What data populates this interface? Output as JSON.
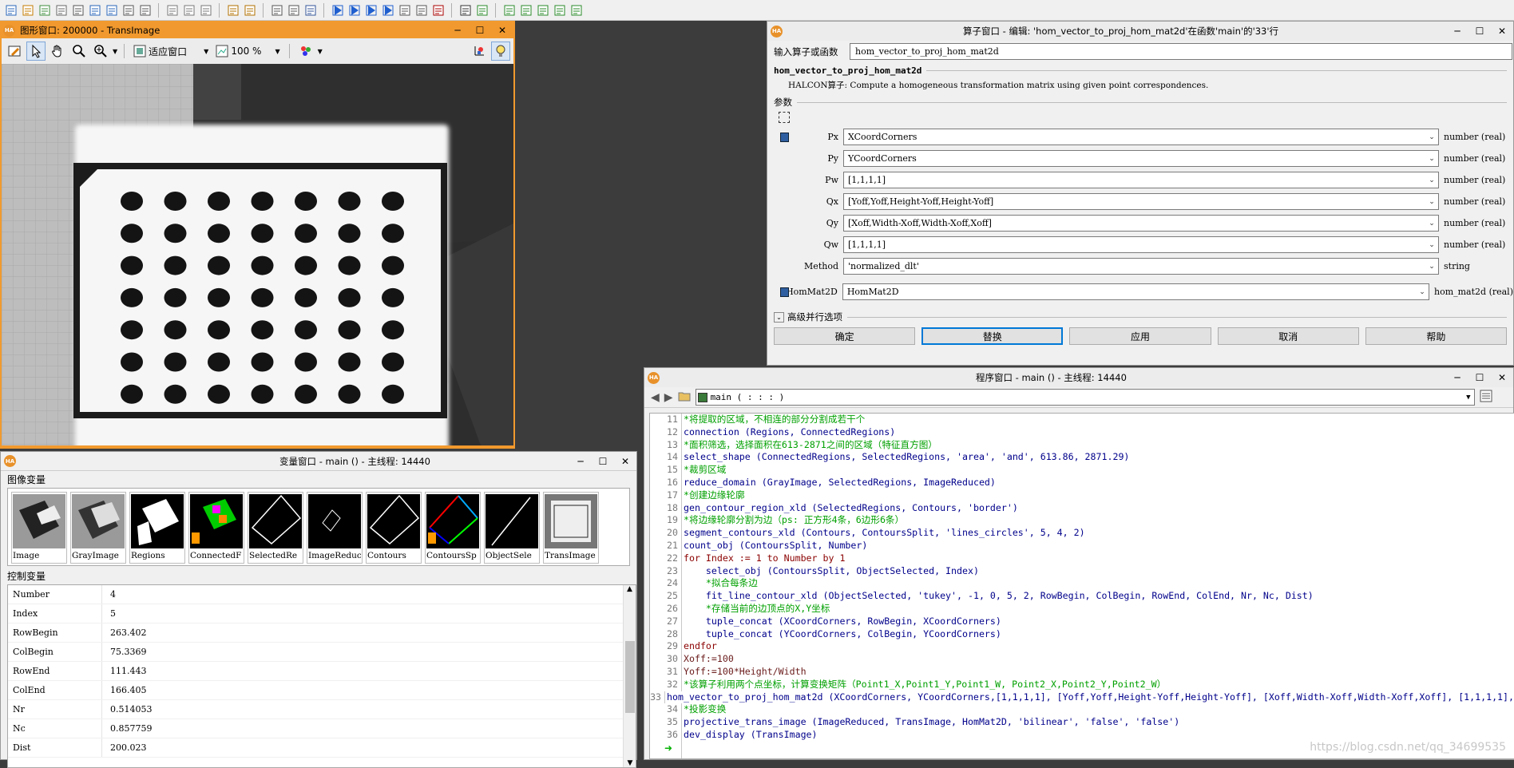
{
  "toolbar": {
    "icons": [
      "new-file-icon",
      "open-icon",
      "open-example-icon",
      "save-icon",
      "save-all-icon",
      "import-icon",
      "export-icon",
      "print-icon",
      "properties-icon",
      "cut-icon",
      "copy-icon",
      "paste-icon",
      "undo-icon",
      "redo-icon",
      "indent-icon",
      "outdent-icon",
      "find-icon",
      "run-icon",
      "step-over-icon",
      "step-into-icon",
      "step-out-icon",
      "stop-icon",
      "reset-icon",
      "breakpoint-icon",
      "profiler-icon",
      "chart-icon",
      "histogram-icon",
      "line-profile-icon",
      "feature-icon",
      "zoom-icon",
      "ocr-icon"
    ]
  },
  "graphics_window": {
    "title": "图形窗口: 200000 - TransImage",
    "fit_label": "适应窗口",
    "zoom_label": "100 %",
    "dots_rows": 7,
    "dots_cols": 7
  },
  "variable_window": {
    "title": "变量窗口 - main () - 主线程: 14440",
    "image_group": "图像变量",
    "control_group": "控制变量",
    "image_vars": [
      "Image",
      "GrayImage",
      "Regions",
      "ConnectedF",
      "SelectedRe",
      "ImageReduc",
      "Contours",
      "ContoursSp",
      "ObjectSele",
      "TransImage"
    ],
    "control_vars": [
      {
        "name": "Number",
        "value": "4"
      },
      {
        "name": "Index",
        "value": "5"
      },
      {
        "name": "RowBegin",
        "value": "263.402"
      },
      {
        "name": "ColBegin",
        "value": "75.3369"
      },
      {
        "name": "RowEnd",
        "value": "111.443"
      },
      {
        "name": "ColEnd",
        "value": "166.405"
      },
      {
        "name": "Nr",
        "value": "0.514053"
      },
      {
        "name": "Nc",
        "value": "0.857759"
      },
      {
        "name": "Dist",
        "value": "200.023"
      }
    ]
  },
  "operator_window": {
    "title": "算子窗口 - 编辑: 'hom_vector_to_proj_hom_mat2d'在函数'main'的'33'行",
    "input_label": "输入算子或函数",
    "input_value": "hom_vector_to_proj_hom_mat2d",
    "op_name": "hom_vector_to_proj_hom_mat2d",
    "description": "HALCON算子: Compute a homogeneous transformation matrix using given point correspondences.",
    "params_label": "参数",
    "params": [
      {
        "name": "Px",
        "value": "XCoordCorners",
        "type": "number (real)"
      },
      {
        "name": "Py",
        "value": "YCoordCorners",
        "type": "number (real)"
      },
      {
        "name": "Pw",
        "value": "[1,1,1,1]",
        "type": "number (real)"
      },
      {
        "name": "Qx",
        "value": "[Yoff,Yoff,Height-Yoff,Height-Yoff]",
        "type": "number (real)"
      },
      {
        "name": "Qy",
        "value": "[Xoff,Width-Xoff,Width-Xoff,Xoff]",
        "type": "number (real)"
      },
      {
        "name": "Qw",
        "value": "[1,1,1,1]",
        "type": "number (real)"
      },
      {
        "name": "Method",
        "value": "'normalized_dlt'",
        "type": "string"
      },
      {
        "name": "HomMat2D",
        "value": "HomMat2D",
        "type": "hom_mat2d (real)"
      }
    ],
    "advanced_label": "高级并行选项",
    "buttons": {
      "ok": "确定",
      "replace": "替换",
      "apply": "应用",
      "cancel": "取消",
      "help": "帮助"
    }
  },
  "program_window": {
    "title": "程序窗口 - main () - 主线程: 14440",
    "proc_label": "main ( : : : )",
    "lines": [
      {
        "n": "11",
        "t": "*将提取的区域，不相连的部分分割成若干个",
        "k": "com"
      },
      {
        "n": "12",
        "t": "connection (Regions, ConnectedRegions)",
        "k": "op"
      },
      {
        "n": "13",
        "t": "*面积筛选，选择面积在613-2871之间的区域（特征直方图）",
        "k": "com"
      },
      {
        "n": "14",
        "t": "select_shape (ConnectedRegions, SelectedRegions, 'area', 'and', 613.86, 2871.29)",
        "k": "op"
      },
      {
        "n": "15",
        "t": "*裁剪区域",
        "k": "com"
      },
      {
        "n": "16",
        "t": "reduce_domain (GrayImage, SelectedRegions, ImageReduced)",
        "k": "op"
      },
      {
        "n": "17",
        "t": "*创建边缘轮廓",
        "k": "com"
      },
      {
        "n": "18",
        "t": "gen_contour_region_xld (SelectedRegions, Contours, 'border')",
        "k": "op"
      },
      {
        "n": "19",
        "t": "*将边缘轮廓分割为边（ps: 正方形4条，6边形6条）",
        "k": "com"
      },
      {
        "n": "20",
        "t": "segment_contours_xld (Contours, ContoursSplit, 'lines_circles', 5, 4, 2)",
        "k": "op"
      },
      {
        "n": "21",
        "t": "count_obj (ContoursSplit, Number)",
        "k": "op"
      },
      {
        "n": "22",
        "t": "for Index := 1 to Number by 1",
        "k": "ctl"
      },
      {
        "n": "23",
        "t": "    select_obj (ContoursSplit, ObjectSelected, Index)",
        "k": "op"
      },
      {
        "n": "24",
        "t": "    *拟合每条边",
        "k": "com"
      },
      {
        "n": "25",
        "t": "    fit_line_contour_xld (ObjectSelected, 'tukey', -1, 0, 5, 2, RowBegin, ColBegin, RowEnd, ColEnd, Nr, Nc, Dist)",
        "k": "op"
      },
      {
        "n": "26",
        "t": "    *存储当前的边顶点的X,Y坐标",
        "k": "com"
      },
      {
        "n": "27",
        "t": "    tuple_concat (XCoordCorners, RowBegin, XCoordCorners)",
        "k": "op"
      },
      {
        "n": "28",
        "t": "    tuple_concat (YCoordCorners, ColBegin, YCoordCorners)",
        "k": "op"
      },
      {
        "n": "29",
        "t": "endfor",
        "k": "ctl"
      },
      {
        "n": "30",
        "t": "Xoff:=100",
        "k": "asg"
      },
      {
        "n": "31",
        "t": "Yoff:=100*Height/Width",
        "k": "asg"
      },
      {
        "n": "32",
        "t": "*该算子利用两个点坐标，计算变换矩阵（Point1_X,Point1_Y,Point1_W, Point2_X,Point2_Y,Point2_W）",
        "k": "com"
      },
      {
        "n": "33",
        "t": "hom_vector_to_proj_hom_mat2d (XCoordCorners, YCoordCorners,[1,1,1,1], [Yoff,Yoff,Height-Yoff,Height-Yoff], [Xoff,Width-Xoff,Width-Xoff,Xoff], [1,1,1,1],",
        "k": "op"
      },
      {
        "n": "34",
        "t": "*投影变换",
        "k": "com"
      },
      {
        "n": "35",
        "t": "projective_trans_image (ImageReduced, TransImage, HomMat2D, 'bilinear', 'false', 'false')",
        "k": "op"
      },
      {
        "n": "36",
        "t": "dev_display (TransImage)",
        "k": "op"
      }
    ],
    "watermark": "https://blog.csdn.net/qq_34699535"
  },
  "colors": {
    "accent_orange": "#f1992e",
    "comment_green": "#00a000",
    "operator_blue": "#00008b",
    "control_red": "#8b0000"
  }
}
